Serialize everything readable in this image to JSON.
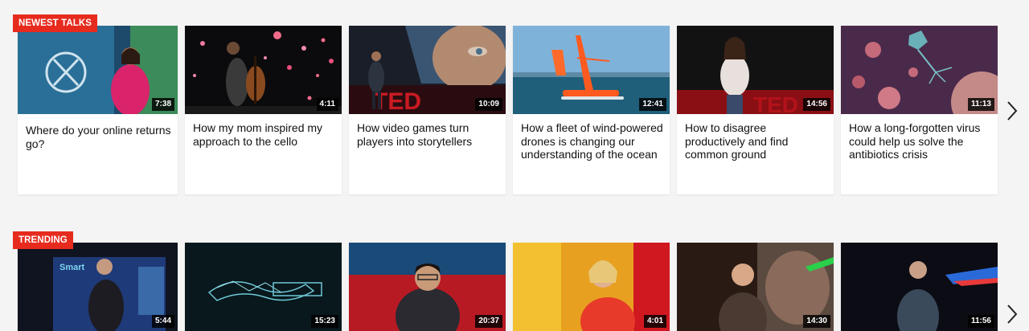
{
  "sections": [
    {
      "label": "NEWEST TALKS",
      "talks": [
        {
          "title": "Where do your online returns go?",
          "duration": "7:38"
        },
        {
          "title": "How my mom inspired my approach to the cello",
          "duration": "4:11"
        },
        {
          "title": "How video games turn players into storytellers",
          "duration": "10:09"
        },
        {
          "title": "How a fleet of wind-powered drones is changing our understanding of the ocean",
          "duration": "12:41"
        },
        {
          "title": "How to disagree productively and find common ground",
          "duration": "14:56"
        },
        {
          "title": "How a long-forgotten virus could help us solve the antibiotics crisis",
          "duration": "11:13"
        }
      ],
      "next_icon": "chevron-right-icon"
    },
    {
      "label": "TRENDING",
      "talks": [
        {
          "duration": "5:44",
          "thumb_text": "Smart"
        },
        {
          "duration": "15:23"
        },
        {
          "duration": "20:37"
        },
        {
          "duration": "4:01"
        },
        {
          "duration": "14:30"
        },
        {
          "duration": "11:56"
        }
      ],
      "next_icon": "chevron-right-icon"
    }
  ],
  "colors": {
    "accent": "#e62b1e",
    "background": "#f4f4f4"
  }
}
